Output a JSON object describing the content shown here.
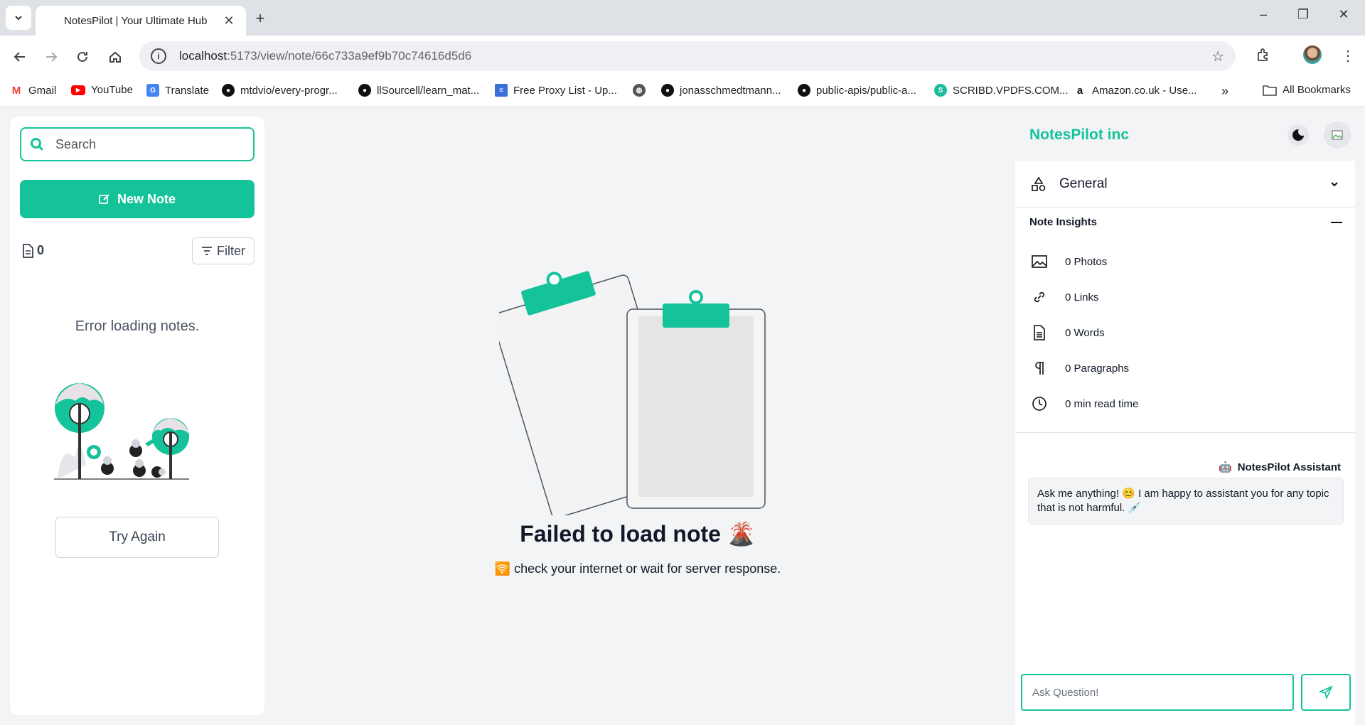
{
  "browser": {
    "tab_title": "NotesPilot | Your Ultimate Hub",
    "new_tab_label": "+",
    "url_host": "localhost",
    "url_rest": ":5173/view/note/66c733a9ef9b70c74616d5d6",
    "bookmarks": [
      {
        "label": "Gmail",
        "icon": "gmail-icon",
        "color": "#ea4335"
      },
      {
        "label": "YouTube",
        "icon": "youtube-icon",
        "color": "#ff0000"
      },
      {
        "label": "Translate",
        "icon": "translate-icon",
        "color": "#4285f4"
      },
      {
        "label": "mtdvio/every-progr...",
        "icon": "github-icon",
        "color": "#111111"
      },
      {
        "label": "llSourcell/learn_mat...",
        "icon": "github-icon",
        "color": "#111111"
      },
      {
        "label": "Free Proxy List - Up...",
        "icon": "proxy-icon",
        "color": "#3b6fd8"
      },
      {
        "label": "",
        "icon": "globe-icon",
        "color": "#555555"
      },
      {
        "label": "jonasschmedtmann...",
        "icon": "github-icon",
        "color": "#111111"
      },
      {
        "label": "public-apis/public-a...",
        "icon": "github-icon",
        "color": "#111111"
      },
      {
        "label": "SCRIBD.VPDFS.COM...",
        "icon": "scribd-icon",
        "color": "#1abc9c"
      },
      {
        "label": "Amazon.co.uk - Use...",
        "icon": "amazon-icon",
        "color": "#111111"
      }
    ],
    "more_bookmarks": "»",
    "all_bookmarks": "All Bookmarks"
  },
  "sidebar": {
    "search_placeholder": "Search",
    "new_note_label": "New Note",
    "note_count": "0",
    "filter_label": "Filter",
    "error_text": "Error loading notes.",
    "try_again_label": "Try Again"
  },
  "main": {
    "fail_title": "Failed to load note 🌋",
    "fail_sub": "🛜 check your internet or wait for server response."
  },
  "right": {
    "brand": "NotesPilot inc",
    "general_label": "General",
    "insights_title": "Note Insights",
    "insights": [
      {
        "icon": "image-icon",
        "label": "0 Photos"
      },
      {
        "icon": "link-icon",
        "label": "0 Links"
      },
      {
        "icon": "document-icon",
        "label": "0 Words"
      },
      {
        "icon": "paragraph-icon",
        "label": "0 Paragraphs"
      },
      {
        "icon": "clock-icon",
        "label": "0 min read time"
      }
    ],
    "assistant_name": "NotesPilot Assistant",
    "assistant_message": "Ask me anything! 😊 I am happy to assistant you for any topic that is not harmful. 💉",
    "ask_placeholder": "Ask Question!"
  },
  "colors": {
    "accent": "#14c39a",
    "background": "#f3f4f6"
  }
}
